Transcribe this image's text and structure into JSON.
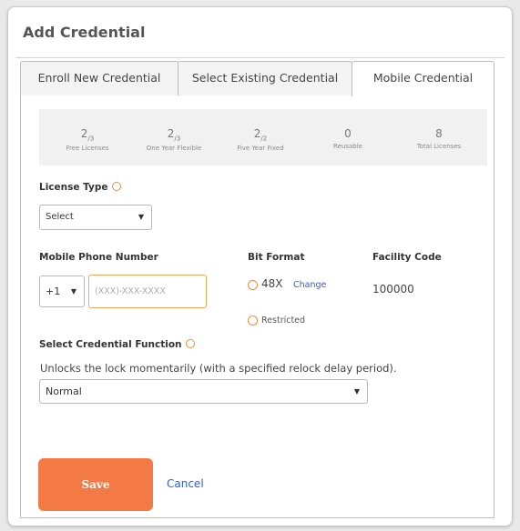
{
  "panel": {
    "title": "Add Credential"
  },
  "tabs": [
    {
      "label": "Enroll New Credential"
    },
    {
      "label": "Select Existing Credential"
    },
    {
      "label": "Mobile Credential"
    }
  ],
  "licenses": [
    {
      "value": "2",
      "sub": "/3",
      "label": "Free Licenses"
    },
    {
      "value": "2",
      "sub": "/3",
      "label": "One Year Flexible"
    },
    {
      "value": "2",
      "sub": "/2",
      "label": "Five Year Fixed"
    },
    {
      "value": "0",
      "sub": "",
      "label": "Reusable"
    },
    {
      "value": "8",
      "sub": "",
      "label": "Total Licenses"
    }
  ],
  "license_type": {
    "label": "License Type",
    "selected": "Select"
  },
  "phone": {
    "label": "Mobile Phone Number",
    "country_code": "+1",
    "placeholder": "(XXX)-XXX-XXXX"
  },
  "bit_format": {
    "label": "Bit Format",
    "value": "48X",
    "change_label": "Change",
    "restricted_label": "Restricted"
  },
  "facility": {
    "label": "Facility Code",
    "value": "100000"
  },
  "function": {
    "label": "Select Credential Function",
    "description": "Unlocks the lock momentarily (with a specified relock delay period).",
    "selected": "Normal"
  },
  "actions": {
    "save_label": "Save",
    "cancel_label": "Cancel"
  },
  "colors": {
    "accent": "#f37a45",
    "link": "#2a5fd6"
  }
}
